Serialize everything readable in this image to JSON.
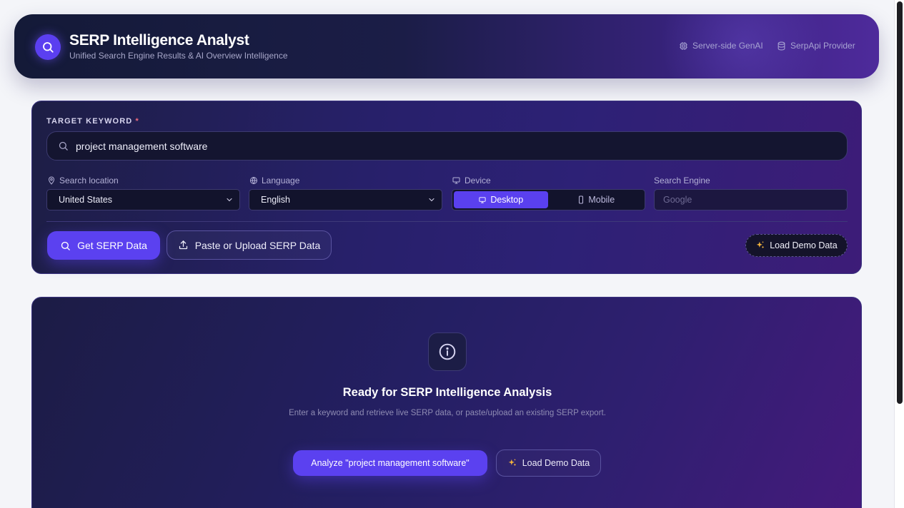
{
  "header": {
    "title": "SERP Intelligence Analyst",
    "subtitle": "Unified Search Engine Results & AI Overview Intelligence",
    "meta": [
      {
        "label": "Server-side GenAI",
        "icon": "chip-icon"
      },
      {
        "label": "SerpApi Provider",
        "icon": "database-icon"
      }
    ]
  },
  "search": {
    "keyword_label": "TARGET KEYWORD",
    "required_mark": "*",
    "keyword_value": "project management software",
    "location": {
      "label": "Search location",
      "value": "United States"
    },
    "language": {
      "label": "Language",
      "value": "English"
    },
    "device": {
      "label": "Device",
      "options": [
        "Desktop",
        "Mobile"
      ],
      "selected": "Desktop"
    },
    "engine": {
      "label": "Search Engine",
      "value": "Google"
    },
    "get_serp_button": "Get SERP Data",
    "paste_button": "Paste or Upload SERP Data",
    "demo_button": "Load Demo Data"
  },
  "empty_state": {
    "title": "Ready for SERP Intelligence Analysis",
    "description": "Enter a keyword and retrieve live SERP data, or paste/upload an existing SERP export.",
    "analyze_button": "Analyze \"project management software\"",
    "demo_button": "Load Demo Data"
  },
  "colors": {
    "accent": "#5b41f0",
    "required": "#f06d7d",
    "sparkle": "#f2b33d"
  }
}
